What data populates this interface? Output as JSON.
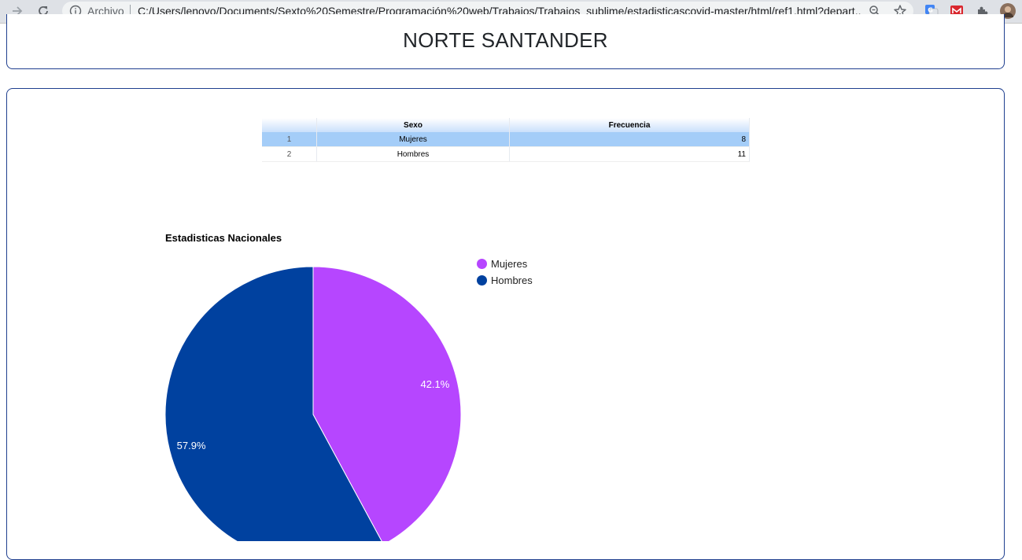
{
  "browser": {
    "scheme_label": "Archivo",
    "url": "C:/Users/lenovo/Documents/Sexto%20Semestre/Programación%20web/Trabajos/Trabajos_sublime/estadisticascovid-master/html/ref1.html?depart..."
  },
  "header": {
    "title": "NORTE SANTANDER"
  },
  "table": {
    "columns": [
      "",
      "Sexo",
      "Frecuencia"
    ],
    "rows": [
      {
        "index": "1",
        "sexo": "Mujeres",
        "frecuencia": "8"
      },
      {
        "index": "2",
        "sexo": "Hombres",
        "frecuencia": "11"
      }
    ]
  },
  "chart_data": {
    "type": "pie",
    "title": "Estadisticas Nacionales",
    "categories": [
      "Mujeres",
      "Hombres"
    ],
    "values": [
      8,
      11
    ],
    "slice_labels": [
      "42.1%",
      "57.9%"
    ],
    "colors": [
      "#b646ff",
      "#00419f"
    ],
    "legend_position": "right"
  }
}
